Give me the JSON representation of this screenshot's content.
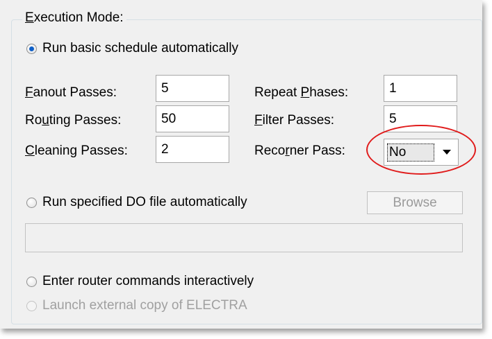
{
  "execution_mode": {
    "legend_first": "E",
    "legend_rest": "xecution Mode:",
    "run_basic": {
      "label": "Run basic schedule automatically",
      "checked": true
    },
    "fanout": {
      "pre": "",
      "u": "F",
      "post": "anout Passes:",
      "value": "5"
    },
    "routing": {
      "pre": "Ro",
      "u": "u",
      "post": "ting Passes:",
      "value": "50"
    },
    "cleaning": {
      "pre": "",
      "u": "C",
      "post": "leaning Passes:",
      "value": "2"
    },
    "repeat": {
      "pre": "Repeat ",
      "u": "P",
      "post": "hases:",
      "value": "1"
    },
    "filter": {
      "pre": "",
      "u": "F",
      "post": "ilter Passes:",
      "value": "5"
    },
    "recorner": {
      "pre": "Reco",
      "u": "r",
      "post": "ner Pass:",
      "value": "No"
    },
    "run_do": {
      "label": "Run specified DO file automatically",
      "checked": false
    },
    "browse_label": "Browse",
    "do_file_path": "",
    "interactive": {
      "label": "Enter router commands interactively",
      "checked": false
    },
    "launch_external": {
      "label": "Launch external copy of ELECTRA",
      "enabled": false
    }
  },
  "colors": {
    "highlight_ring": "#e01b1b",
    "radio_dot": "#0f5fc7"
  }
}
